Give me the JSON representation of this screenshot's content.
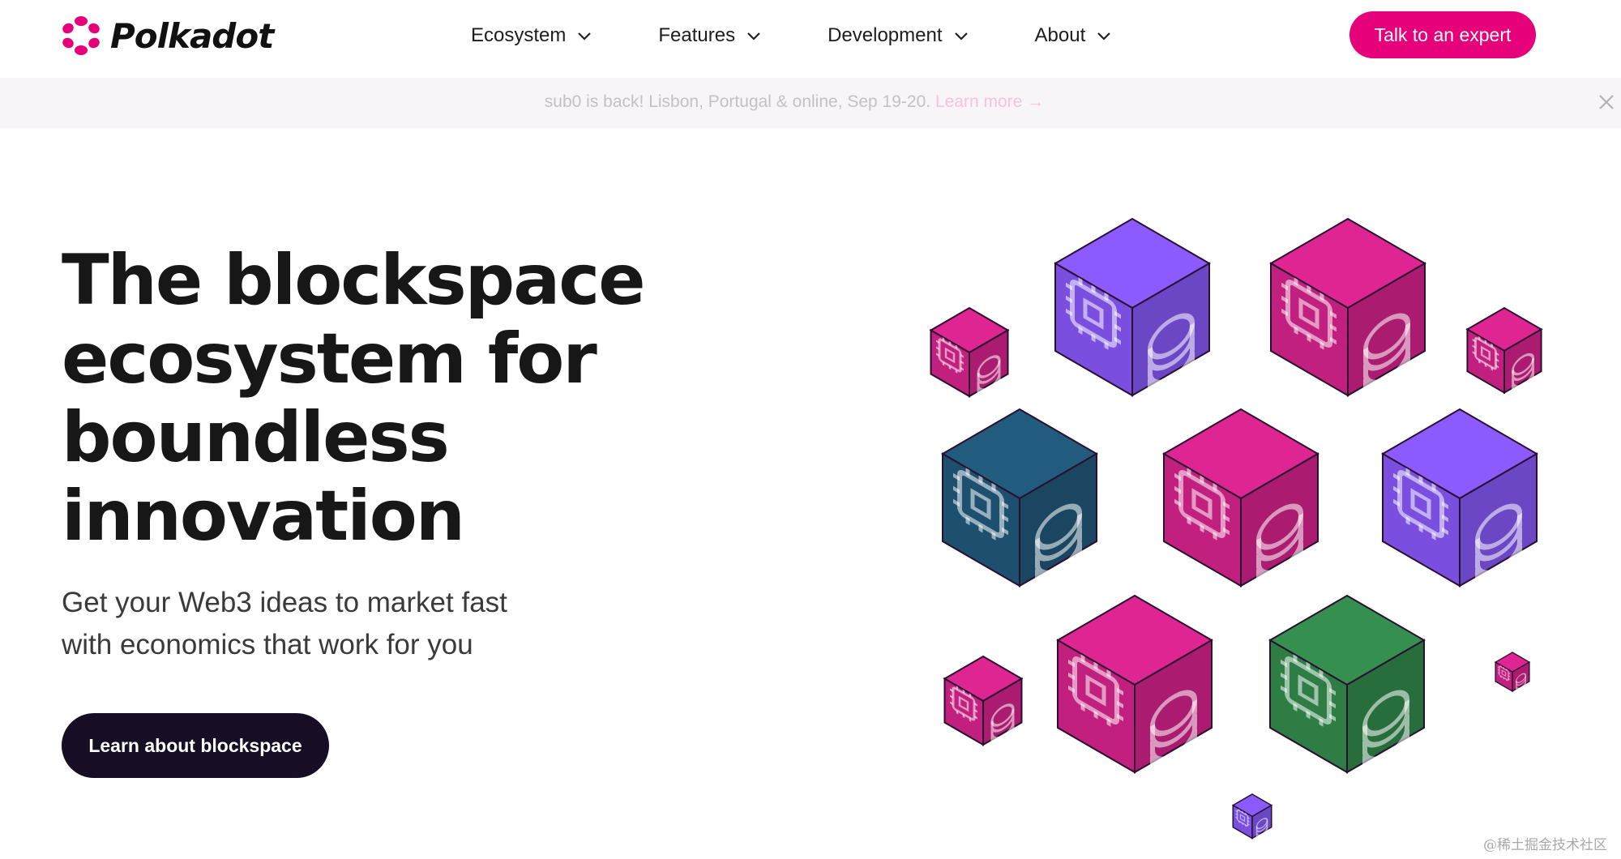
{
  "nav": {
    "brand": "Polkadot",
    "items": [
      {
        "label": "Ecosystem"
      },
      {
        "label": "Features"
      },
      {
        "label": "Development"
      },
      {
        "label": "About"
      }
    ],
    "cta_label": "Talk to an expert"
  },
  "banner": {
    "text": "sub0 is back! Lisbon, Portugal & online, Sep 19-20.",
    "link": "Learn more →"
  },
  "hero": {
    "title_lines": [
      "The blockspace",
      "ecosystem for",
      "boundless",
      "innovation"
    ],
    "subtitle_lines": [
      "Get your Web3 ideas to market fast",
      "with economics that work for you"
    ],
    "button_label": "Learn about blockspace"
  },
  "watermark": "@稀土掘金技术社区",
  "colors": {
    "brand_pink": "#e6007a",
    "dark_button": "#170d24",
    "cube_pink": "#c2207f",
    "cube_purple": "#7a4fe0",
    "cube_teal": "#1d4f6e",
    "cube_green": "#2e7d45"
  },
  "icons": {
    "logo": "polkadot-dots-logo",
    "chevron": "chevron-down-icon",
    "close": "close-icon",
    "cube_chip": "cpu-chip-icon",
    "cube_coins": "coin-stack-icon"
  }
}
